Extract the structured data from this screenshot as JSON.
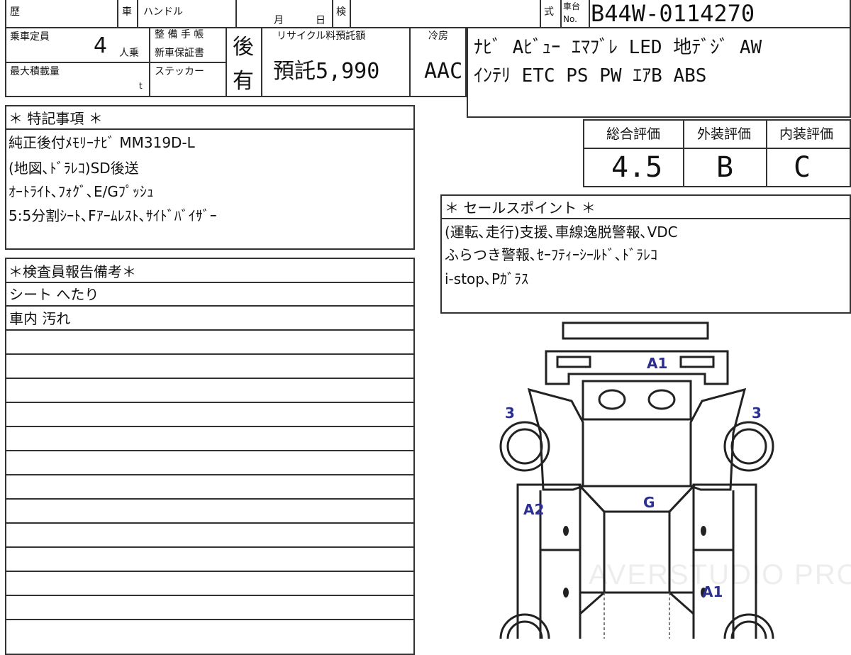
{
  "header": {
    "label_history": "歴",
    "label_car": "車",
    "label_handle": "ハンドル",
    "label_month": "月",
    "label_day": "日",
    "label_inspection": "検",
    "label_model": "式",
    "label_chassis_no_top": "車台",
    "label_chassis_no_bottom": "No.",
    "chassis_no": "B44W-0114270"
  },
  "specs": {
    "label_capacity": "乗車定員",
    "capacity_value": "4",
    "capacity_unit": "人乗",
    "label_max_load": "最大積載量",
    "max_load_unit": "t",
    "label_maintenance_line1": "整 備 手 帳",
    "label_maintenance_line2": "新車保証書",
    "label_sticker": "ステッカー",
    "maintenance_value": "後",
    "sticker_value": "有",
    "label_recycle": "リサイクル料預託額",
    "recycle_value": "預託5,990",
    "label_aircon": "冷房",
    "aircon_value": "AAC"
  },
  "equipment": {
    "line1": "ﾅﾋﾞ Aﾋﾞｭｰ ｴﾏﾌﾞﾚ LED 地ﾃﾞｼﾞ AW",
    "line2": "ｲﾝﾃﾘ ETC PS PW ｴｱB ABS"
  },
  "special_notes": {
    "title": "＊ 特記事項 ＊",
    "lines": [
      "純正後付ﾒﾓﾘｰﾅﾋﾞ MM319D-L",
      "(地図､ﾄﾞﾗﾚｺ)SD後送",
      "ｵｰﾄﾗｲﾄ､ﾌｫｸﾞ､E/Gﾌﾟｯｼｭ",
      "5:5分割ｼｰﾄ､Fｱｰﾑﾚｽﾄ､ｻｲﾄﾞﾊﾞｲｻﾞｰ"
    ]
  },
  "grades": {
    "overall_label": "総合評価",
    "overall_value": "4.5",
    "exterior_label": "外装評価",
    "exterior_value": "B",
    "interior_label": "内装評価",
    "interior_value": "C"
  },
  "sales_points": {
    "title": "＊ セールスポイント ＊",
    "lines": [
      "(運転､走行)支援､車線逸脱警報､VDC",
      "ふらつき警報､ｾｰﾌﾃｨｰｼｰﾙﾄﾞ､ﾄﾞﾗﾚｺ",
      "i-stop､Pｶﾞﾗｽ"
    ]
  },
  "inspector_notes": {
    "title": "＊検査員報告備考＊",
    "lines": [
      "シート へたり",
      "車内 汚れ",
      "",
      "",
      "",
      "",
      "",
      "",
      "",
      "",
      "",
      "",
      "",
      ""
    ]
  },
  "damage_map": {
    "marks": {
      "front_bumper": "A1",
      "left_front_fender": "3",
      "right_front_fender": "3",
      "left_front_door": "A2",
      "roof": "G",
      "right_rear_door": "A1"
    }
  },
  "watermark": "AVERSTUDIO PRO",
  "colors": {
    "line": "#333333",
    "mark_blue": "#2b2f8f"
  }
}
